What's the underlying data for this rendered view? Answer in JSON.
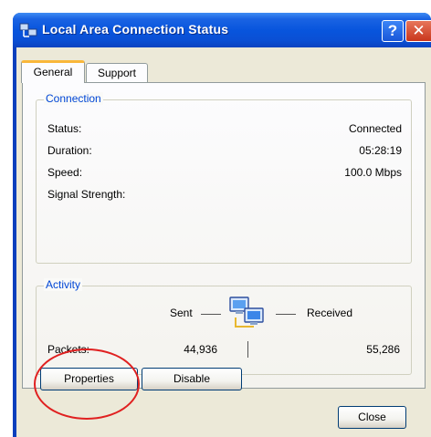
{
  "window": {
    "title": "Local Area Connection Status",
    "help_glyph": "?",
    "close_glyph": "✕"
  },
  "tabs": [
    {
      "label": "General",
      "selected": true
    },
    {
      "label": "Support",
      "selected": false
    }
  ],
  "connection": {
    "legend": "Connection",
    "rows": [
      {
        "label": "Status:",
        "value": "Connected"
      },
      {
        "label": "Duration:",
        "value": "05:28:19"
      },
      {
        "label": "Speed:",
        "value": "100.0 Mbps"
      },
      {
        "label": "Signal Strength:",
        "value": ""
      }
    ]
  },
  "activity": {
    "legend": "Activity",
    "sent_label": "Sent",
    "received_label": "Received",
    "packets_label": "Packets:",
    "packets_sent": "44,936",
    "packets_received": "55,286",
    "icon": "network-computers-icon"
  },
  "buttons": {
    "properties": "Properties",
    "disable": "Disable",
    "close": "Close"
  },
  "colors": {
    "titlebar": "#0855dd",
    "group_legend": "#0046d5",
    "annotation": "#e02020",
    "selected_tab_accent": "#f9b73a"
  }
}
